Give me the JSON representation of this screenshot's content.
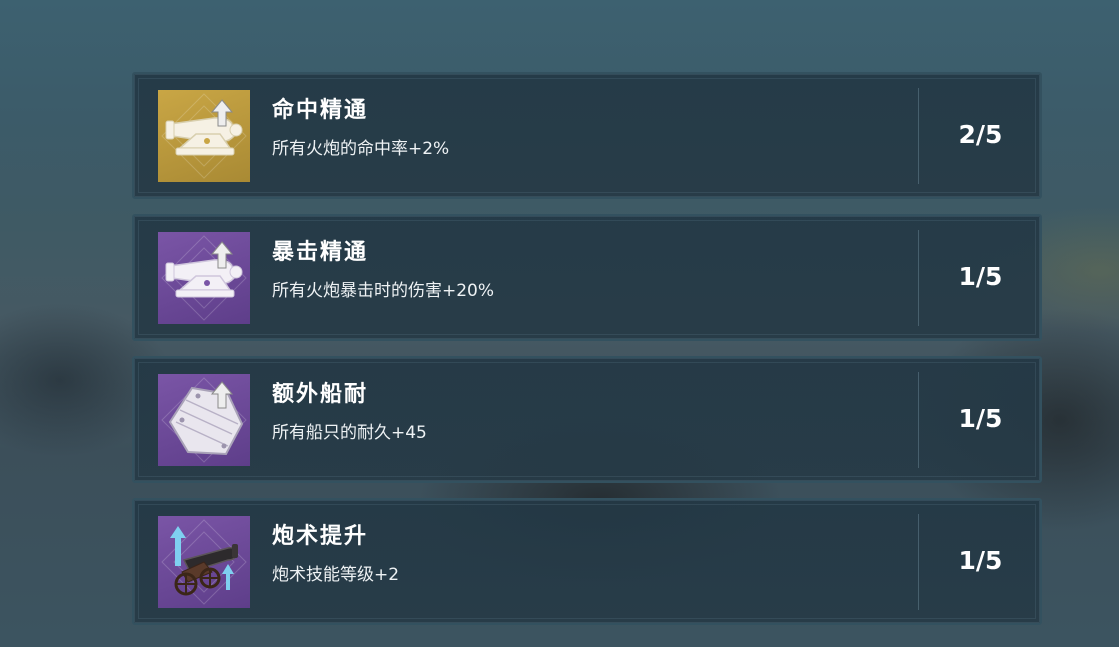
{
  "skills": [
    {
      "title": "命中精通",
      "desc": "所有火炮的命中率+2%",
      "level": "2/5",
      "icon": "cannon-upgrade-icon",
      "tile_color": "#c9a645"
    },
    {
      "title": "暴击精通",
      "desc": "所有火炮暴击时的伤害+20%",
      "level": "1/5",
      "icon": "cannon-upgrade-icon",
      "tile_color": "#7a55a6"
    },
    {
      "title": "额外船耐",
      "desc": "所有船只的耐久+45",
      "level": "1/5",
      "icon": "hull-plate-upgrade-icon",
      "tile_color": "#7a55a6"
    },
    {
      "title": "炮术提升",
      "desc": "炮术技能等级+2",
      "level": "1/5",
      "icon": "field-cannon-icon",
      "tile_color": "#7a55a6"
    }
  ]
}
